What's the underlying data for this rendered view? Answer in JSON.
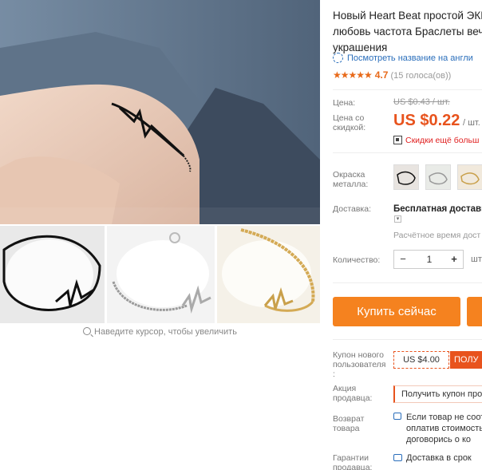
{
  "gallery": {
    "zoom_hint": "Наведите курсор, чтобы увеличить",
    "thumbnails": [
      "black-bracelet",
      "silver-bracelet",
      "gold-bracelet"
    ]
  },
  "product": {
    "title_lines": [
      "Новый Heart Beat простой ЭКІ",
      "любовь частота Браслеты веч",
      "украшения"
    ],
    "translate_link": "Посмотреть название на англи",
    "rating_value": "4.7",
    "rating_votes": "(15 голоса(ов))",
    "stars": "★★★★★"
  },
  "price": {
    "label": "Цена:",
    "old_value": "US $0.43 / шт.",
    "discount_label_line1": "Цена со",
    "discount_label_line2": "скидкой:",
    "new_value": "US $0.22",
    "unit": "/ шт.",
    "more_discounts": "Скидки ещё больш"
  },
  "options": {
    "metal_color_label_line1": "Окраска",
    "metal_color_label_line2": "металла:",
    "shipping_label": "Доставка:",
    "shipping_value": "Бесплатная доставка",
    "shipping_time": "Расчётное время дост",
    "quantity_label": "Количество:",
    "quantity_minus": "−",
    "quantity_value": "1",
    "quantity_plus": "+",
    "quantity_unit": "шт"
  },
  "actions": {
    "buy_now": "Купить сейчас"
  },
  "coupons": {
    "new_user_label_line1": "Купон нового",
    "new_user_label_line2": "пользователя",
    "new_user_label_line3": ":",
    "new_user_value": "US $4.00",
    "new_user_get": "ПОЛУ",
    "seller_label_line1": "Акция",
    "seller_label_line2": "продавца:",
    "seller_value": "Получить купон про"
  },
  "returns": {
    "label_line1": "Возврат",
    "label_line2": "товара",
    "text_lines": [
      "Если товар не соот",
      "оплатив стоимость",
      "договорись о ко"
    ]
  },
  "guarantee": {
    "label_line1": "Гарантии",
    "label_line2": "продавца:",
    "text": "Доставка в срок"
  },
  "colors": {
    "accent": "#f5821f",
    "price": "#e8531d",
    "link": "#2a6ebb",
    "star": "#e86a1a"
  }
}
